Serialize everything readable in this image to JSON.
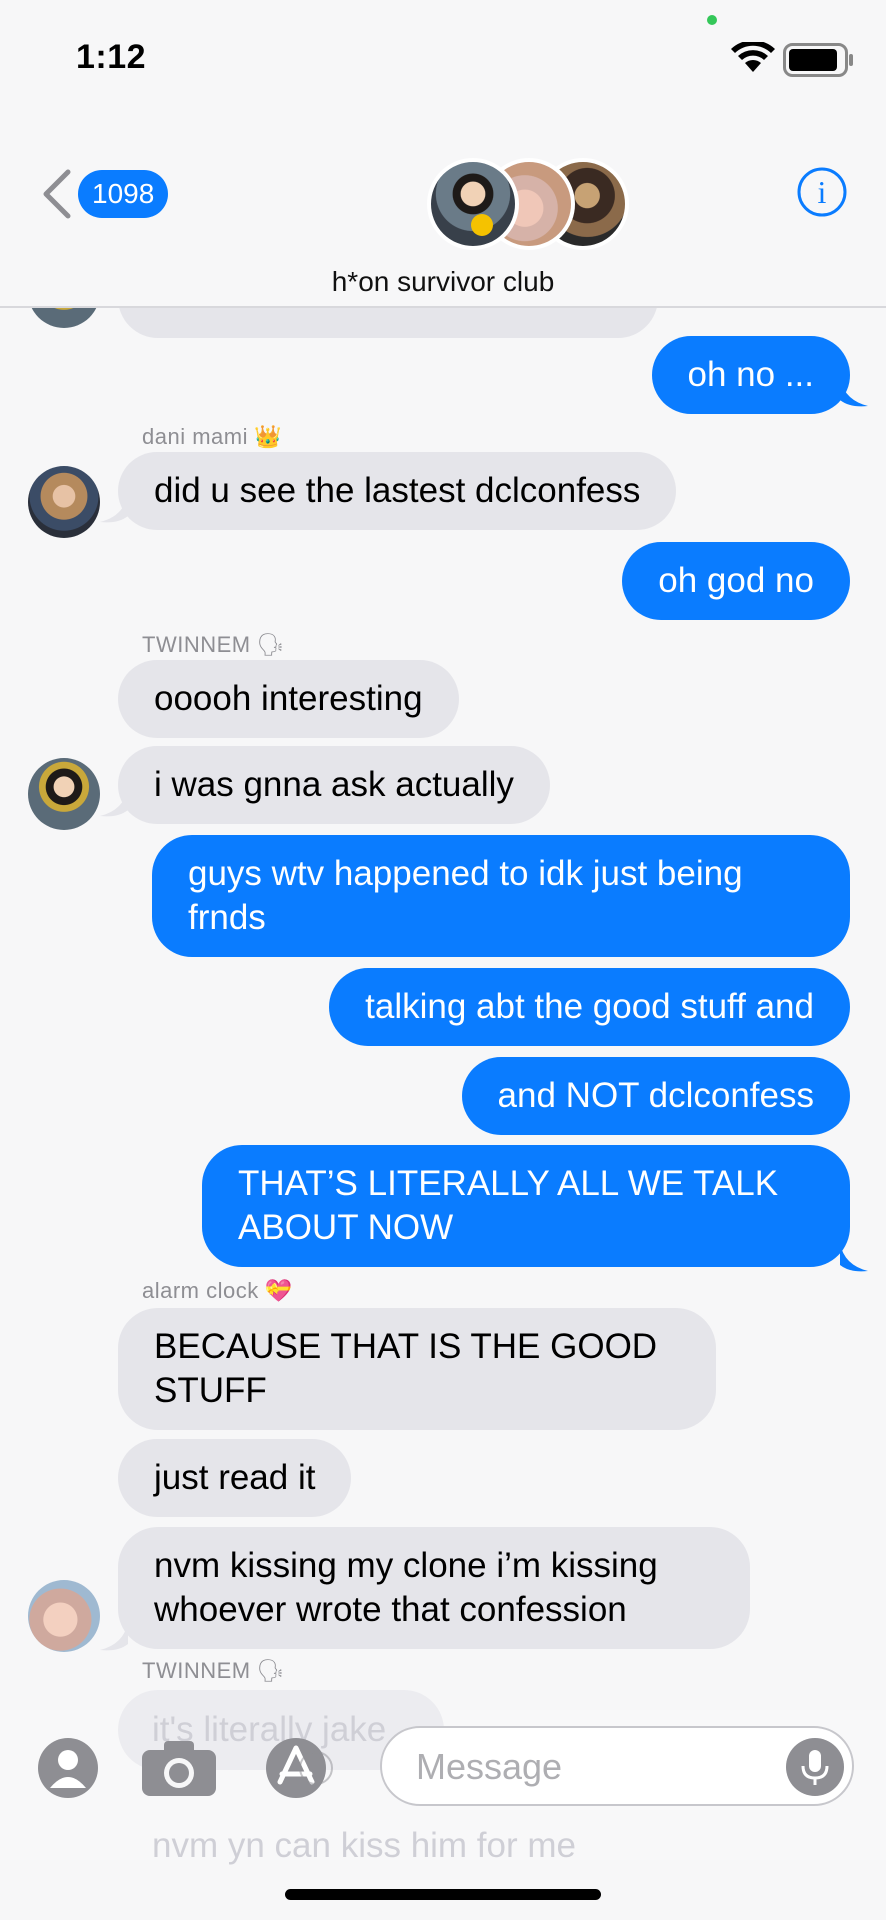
{
  "status": {
    "time": "1:12"
  },
  "nav": {
    "back_count": "1098",
    "group_name": "h*on survivor club"
  },
  "messages": [
    {
      "dir": "out",
      "text": "oh no ..."
    },
    {
      "sender": "dani mami",
      "sender_emoji": "👑"
    },
    {
      "dir": "in",
      "text": "did u see the lastest dclconfess"
    },
    {
      "dir": "out",
      "text": "oh god no"
    },
    {
      "sender": "TWINNEM",
      "sender_emoji": "🗣"
    },
    {
      "dir": "in",
      "text": "ooooh interesting"
    },
    {
      "dir": "in",
      "text": "i was gnna ask actually"
    },
    {
      "dir": "out",
      "text": "guys wtv happened to idk just being",
      "text2": "frnds"
    },
    {
      "dir": "out",
      "text": "talking abt the good stuff and"
    },
    {
      "dir": "out",
      "text": "and NOT dclconfess"
    },
    {
      "dir": "out",
      "text": "THAT’S LITERALLY ALL WE TALK",
      "text2": "ABOUT NOW"
    },
    {
      "sender": "alarm clock",
      "sender_emoji": "💝"
    },
    {
      "dir": "in",
      "text": "BECAUSE THAT IS THE GOOD",
      "text2": "STUFF"
    },
    {
      "dir": "in",
      "text": "just read it"
    },
    {
      "dir": "in",
      "text": "nvm kissing my clone i’m kissing",
      "text2": "whoever wrote that confession"
    },
    {
      "sender": "TWINNEM",
      "sender_emoji": "🗣"
    }
  ],
  "ghost": {
    "line1": "it's literally jake",
    "line2": "nvm yn can kiss him for me"
  },
  "input": {
    "placeholder": "Message",
    "icons": [
      "contact-icon",
      "camera-icon",
      "app-store-icon",
      "mic-icon"
    ]
  },
  "colors": {
    "accent": "#0a7cff",
    "incoming": "#e5e5ea"
  }
}
